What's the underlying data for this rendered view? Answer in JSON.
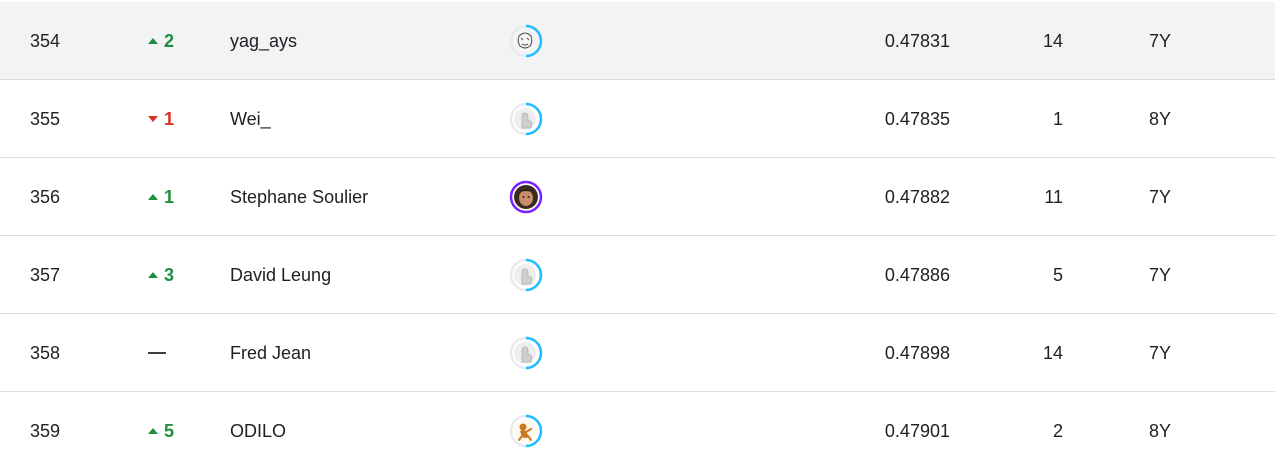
{
  "leaderboard": {
    "rows": [
      {
        "rank": "354",
        "delta": "2",
        "trend": "up",
        "name": "yag_ays",
        "avatar_icon": "sketch-avatar-icon",
        "ring_color": "#20beff",
        "score": "0.47831",
        "entries": "14",
        "last": "7Y"
      },
      {
        "rank": "355",
        "delta": "1",
        "trend": "down",
        "name": "Wei_",
        "avatar_icon": "default-avatar-icon",
        "ring_color": "#20beff",
        "score": "0.47835",
        "entries": "1",
        "last": "8Y"
      },
      {
        "rank": "356",
        "delta": "1",
        "trend": "up",
        "name": "Stephane Soulier",
        "avatar_icon": "photo-avatar-icon",
        "ring_color": "#7a1fff",
        "score": "0.47882",
        "entries": "11",
        "last": "7Y"
      },
      {
        "rank": "357",
        "delta": "3",
        "trend": "up",
        "name": "David Leung",
        "avatar_icon": "default-avatar-icon",
        "ring_color": "#20beff",
        "score": "0.47886",
        "entries": "5",
        "last": "7Y"
      },
      {
        "rank": "358",
        "delta": "",
        "trend": "same",
        "name": "Fred Jean",
        "avatar_icon": "default-avatar-icon",
        "ring_color": "#20beff",
        "score": "0.47898",
        "entries": "14",
        "last": "7Y"
      },
      {
        "rank": "359",
        "delta": "5",
        "trend": "up",
        "name": "ODILO",
        "avatar_icon": "monkey-avatar-icon",
        "ring_color": "#20beff",
        "score": "0.47901",
        "entries": "2",
        "last": "8Y"
      }
    ]
  }
}
